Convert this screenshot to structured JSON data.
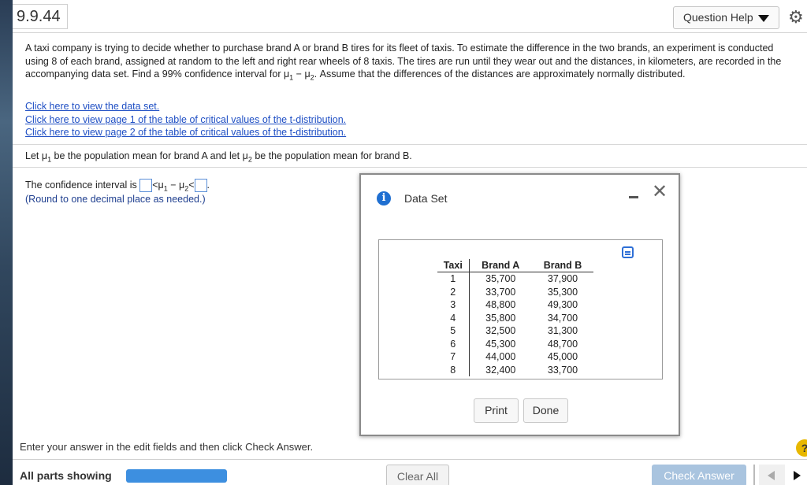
{
  "header": {
    "question_id": "9.9.44",
    "help_label": "Question Help"
  },
  "problem": {
    "text_1": "A taxi company is trying to decide whether to purchase brand A or brand B tires for its fleet of taxis. To estimate the difference in the two brands, an experiment is conducted using 8 of each brand, assigned at random to the left and right rear wheels of 8 taxis. The tires are run until they wear out and the distances, in kilometers, are recorded in the accompanying data set. Find a 99% confidence interval for ",
    "mu": "μ",
    "sub1": "1",
    "minus": " − ",
    "sub2": "2",
    "text_2": ". Assume that the differences of the distances are approximately normally distributed."
  },
  "links": [
    "Click here to view the data set.",
    "Click here to view page 1 of the table of critical values of the t-distribution.",
    "Click here to view page 2 of the table of critical values of the t-distribution."
  ],
  "let_line": {
    "a": "Let ",
    "b": " be the population mean for brand A and let ",
    "c": " be the population mean for brand B."
  },
  "ci": {
    "prefix": "The confidence interval is ",
    "lt1": "<",
    "lt2": "<",
    "suffix": ".",
    "round_note": "(Round to one decimal place as needed.)"
  },
  "dialog": {
    "title": "Data Set",
    "columns": [
      "Taxi",
      "Brand A",
      "Brand B"
    ],
    "rows": [
      [
        "1",
        "35,700",
        "37,900"
      ],
      [
        "2",
        "33,700",
        "35,300"
      ],
      [
        "3",
        "48,800",
        "49,300"
      ],
      [
        "4",
        "35,800",
        "34,700"
      ],
      [
        "5",
        "32,500",
        "31,300"
      ],
      [
        "6",
        "45,300",
        "48,700"
      ],
      [
        "7",
        "44,000",
        "45,000"
      ],
      [
        "8",
        "32,400",
        "33,700"
      ]
    ],
    "print_label": "Print",
    "done_label": "Done"
  },
  "footer": {
    "instructions": "Enter your answer in the edit fields and then click Check Answer.",
    "parts_label": "All parts showing",
    "progress": 1.0,
    "clear_label": "Clear All",
    "check_label": "Check Answer",
    "help_glyph": "?"
  }
}
